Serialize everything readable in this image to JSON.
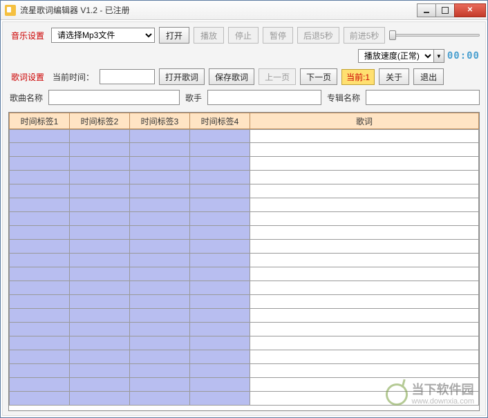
{
  "window": {
    "title": "流星歌词编辑器 V1.2 - 已注册"
  },
  "toolbar1": {
    "section_label": "音乐设置",
    "file_placeholder": "请选择Mp3文件",
    "open": "打开",
    "play": "播放",
    "stop": "停止",
    "pause": "暂停",
    "back5": "后退5秒",
    "fwd5": "前进5秒",
    "speed_label": "播放速度(正常)",
    "time_display": "00:00"
  },
  "toolbar2": {
    "section_label": "歌词设置",
    "current_time_label": "当前时间：",
    "current_time_value": "",
    "open_lyric": "打开歌词",
    "save_lyric": "保存歌词",
    "prev_page": "上一页",
    "next_page": "下一页",
    "current_badge": "当前:1",
    "about": "关于",
    "exit": "退出"
  },
  "meta": {
    "song_label": "歌曲名称",
    "song_value": "",
    "singer_label": "歌手",
    "singer_value": "",
    "album_label": "专辑名称",
    "album_value": ""
  },
  "table": {
    "headers": {
      "ts1": "时间标签1",
      "ts2": "时间标签2",
      "ts3": "时间标签3",
      "ts4": "时间标签4",
      "lyric": "歌词"
    },
    "row_count": 20
  },
  "watermark": {
    "main": "当下软件园",
    "sub": "www.downxia.com"
  }
}
